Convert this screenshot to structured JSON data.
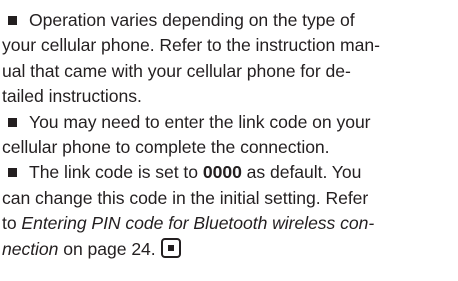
{
  "paragraph1": {
    "line1": "Operation varies depending on the type of",
    "line2": "your cellular phone. Refer to the instruction man-",
    "line3": "ual that came with your cellular phone for de-",
    "line4": "tailed instructions."
  },
  "paragraph2": {
    "line1": "You may need to enter the link code on your",
    "line2": "cellular phone to complete the connection."
  },
  "paragraph3": {
    "line1_before": "The link code is set to ",
    "line1_code": "0000",
    "line1_after": " as default. You",
    "line2": "can change this code in the initial setting. Refer",
    "line3_before": "to ",
    "line3_ref": "Entering PIN code for Bluetooth wireless con-",
    "line4_ref": "nection",
    "line4_after": " on page 24."
  },
  "icons": {
    "bullet": "black-square-bullet-icon",
    "end_mark": "end-of-section-icon"
  }
}
